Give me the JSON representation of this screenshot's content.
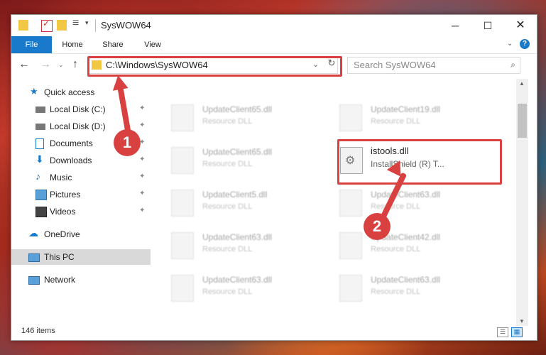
{
  "window": {
    "title": "SysWOW64",
    "controls": {
      "minimize": "─",
      "maximize": "☐",
      "close": "✕"
    }
  },
  "ribbon": {
    "tabs": [
      "File",
      "Home",
      "Share",
      "View"
    ],
    "expand": "⌄",
    "help": "?"
  },
  "addressbar": {
    "back": "←",
    "forward": "→",
    "history": "⌄",
    "up": "↑",
    "path": "C:\\Windows\\SysWOW64",
    "chevron": "⌄",
    "refresh": "↻",
    "search_placeholder": "Search SysWOW64",
    "search_icon": "⌕"
  },
  "sidebar": {
    "items": [
      {
        "label": "Quick access",
        "icon": "star-icon",
        "pinned": false
      },
      {
        "label": "Local Disk (C:)",
        "icon": "drive-icon",
        "pinned": true
      },
      {
        "label": "Local Disk (D:)",
        "icon": "drive-icon",
        "pinned": true
      },
      {
        "label": "Documents",
        "icon": "documents-icon",
        "pinned": true
      },
      {
        "label": "Downloads",
        "icon": "download-icon",
        "pinned": true
      },
      {
        "label": "Music",
        "icon": "music-icon",
        "pinned": true
      },
      {
        "label": "Pictures",
        "icon": "pictures-icon",
        "pinned": true
      },
      {
        "label": "Videos",
        "icon": "videos-icon",
        "pinned": true
      },
      {
        "label": "OneDrive",
        "icon": "cloud-icon",
        "pinned": false
      },
      {
        "label": "This PC",
        "icon": "pc-icon",
        "pinned": false,
        "selected": true
      },
      {
        "label": "Network",
        "icon": "network-icon",
        "pinned": false
      }
    ],
    "pin_glyph": "📌"
  },
  "files": [
    {
      "name": "UpdateClient65.dll",
      "type": "Resource DLL"
    },
    {
      "name": "UpdateClient19.dll",
      "type": "Resource DLL"
    },
    {
      "name": "UpdateClient65.dll",
      "type": "Resource DLL"
    },
    {
      "name": "UpdateClient5.dll",
      "type": "Resource DLL"
    },
    {
      "name": "UpdateClient63.dll",
      "type": "Resource DLL"
    },
    {
      "name": "UpdateClient63.dll",
      "type": "Resource DLL"
    },
    {
      "name": "UpdateClient42.dll",
      "type": "Resource DLL"
    },
    {
      "name": "UpdateClient63.dll",
      "type": "Resource DLL"
    },
    {
      "name": "UpdateClient63.dll",
      "type": "Resource DLL"
    }
  ],
  "target_file": {
    "name": "istools.dll",
    "type": "InstallShield (R) T..."
  },
  "status": {
    "count": "146 items"
  },
  "annotations": {
    "badge1": "1",
    "badge2": "2",
    "color": "#d94141"
  }
}
